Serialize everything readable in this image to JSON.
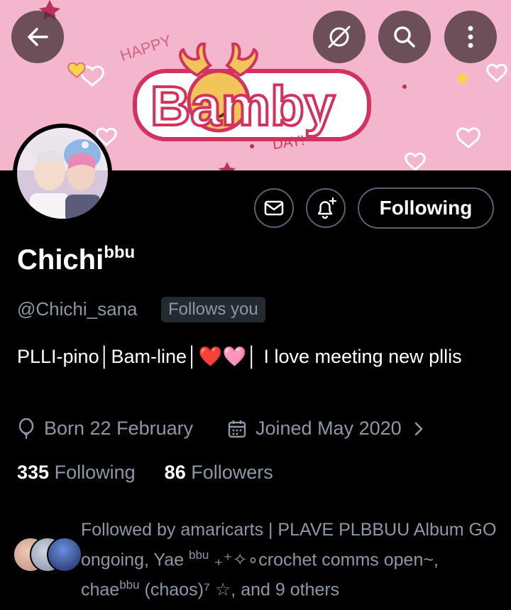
{
  "header": {
    "back_icon": "arrow-left-icon",
    "spaces_icon": "spaces-off-icon",
    "search_icon": "search-icon",
    "more_icon": "more-vertical-icon"
  },
  "banner": {
    "happy_text": "HAPPY",
    "title_text": "Bamby",
    "day_text": "DAY!",
    "background_color": "#f3b6cd"
  },
  "actions": {
    "message_icon": "mail-icon",
    "notify_icon": "bell-plus-icon",
    "follow_label": "Following"
  },
  "profile": {
    "name": "Chichi",
    "name_sup": "bbu",
    "handle": "@Chichi_sana",
    "follows_you": "Follows you",
    "bio_line1": "PLLI-pino│Bam-line│",
    "bio_hearts": "❤️🩷",
    "bio_line2": "│ I love meeting new pllis",
    "birthday": "Born 22 February",
    "joined": "Joined May 2020"
  },
  "stats": {
    "following_count": "335",
    "following_label": "Following",
    "followers_count": "86",
    "followers_label": "Followers"
  },
  "followed_by": {
    "prefix": "Followed by amaricarts | PLAVE PLBBUU Album GO ongoing, Yae ",
    "sup1": "bbu",
    "middle": " ₊⁺✧∘crochet comms open~, chae",
    "sup2": "bbu",
    "suffix": " (chaos)⁷ ☆, and 9 others"
  }
}
